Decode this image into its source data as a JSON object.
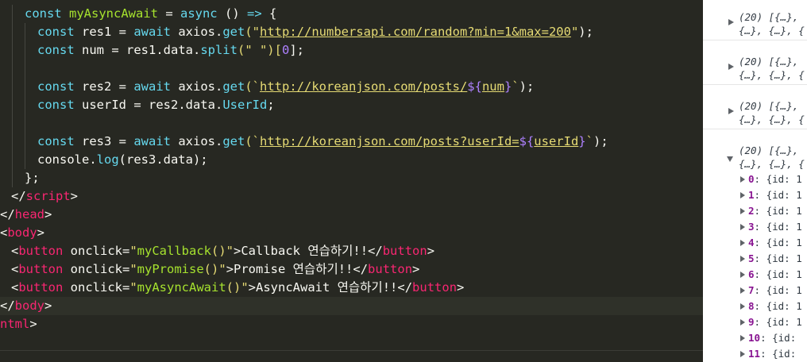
{
  "editor": {
    "lines": [
      [
        {
          "t": "const ",
          "c": "kw"
        },
        {
          "t": "myAsyncAwait",
          "c": "fn"
        },
        {
          "t": " = ",
          "c": "punct"
        },
        {
          "t": "async",
          "c": "kw"
        },
        {
          "t": " () ",
          "c": "punct"
        },
        {
          "t": "=>",
          "c": "kw"
        },
        {
          "t": " {",
          "c": "punct"
        }
      ],
      [
        {
          "t": "const ",
          "c": "kw"
        },
        {
          "t": "res1 = ",
          "c": "var"
        },
        {
          "t": "await ",
          "c": "kw"
        },
        {
          "t": "axios.",
          "c": "var"
        },
        {
          "t": "get",
          "c": "meth"
        },
        {
          "t": "(\"",
          "c": "str"
        },
        {
          "t": "http://numbersapi.com/random?min=1&max=200",
          "c": "url"
        },
        {
          "t": "\"",
          "c": "str"
        },
        {
          "t": ");",
          "c": "punct"
        }
      ],
      [
        {
          "t": "const ",
          "c": "kw"
        },
        {
          "t": "num = res1.data.",
          "c": "var"
        },
        {
          "t": "split",
          "c": "meth"
        },
        {
          "t": "(\" \")[",
          "c": "str"
        },
        {
          "t": "0",
          "c": "num"
        },
        {
          "t": "];",
          "c": "punct"
        }
      ],
      [],
      [
        {
          "t": "const ",
          "c": "kw"
        },
        {
          "t": "res2 = ",
          "c": "var"
        },
        {
          "t": "await ",
          "c": "kw"
        },
        {
          "t": "axios.",
          "c": "var"
        },
        {
          "t": "get",
          "c": "meth"
        },
        {
          "t": "(`",
          "c": "str"
        },
        {
          "t": "http://koreanjson.com/posts/",
          "c": "url"
        },
        {
          "t": "${",
          "c": "interp"
        },
        {
          "t": "num",
          "c": "url"
        },
        {
          "t": "}",
          "c": "interp"
        },
        {
          "t": "`",
          "c": "str"
        },
        {
          "t": ");",
          "c": "punct"
        }
      ],
      [
        {
          "t": "const ",
          "c": "kw"
        },
        {
          "t": "userId = res2.data.",
          "c": "var"
        },
        {
          "t": "UserId",
          "c": "meth"
        },
        {
          "t": ";",
          "c": "punct"
        }
      ],
      [],
      [
        {
          "t": "const ",
          "c": "kw"
        },
        {
          "t": "res3 = ",
          "c": "var"
        },
        {
          "t": "await ",
          "c": "kw"
        },
        {
          "t": "axios.",
          "c": "var"
        },
        {
          "t": "get",
          "c": "meth"
        },
        {
          "t": "(`",
          "c": "str"
        },
        {
          "t": "http://koreanjson.com/posts?userId=",
          "c": "url"
        },
        {
          "t": "${",
          "c": "interp"
        },
        {
          "t": "userId",
          "c": "url"
        },
        {
          "t": "}",
          "c": "interp"
        },
        {
          "t": "`",
          "c": "str"
        },
        {
          "t": ");",
          "c": "punct"
        }
      ],
      [
        {
          "t": "console.",
          "c": "var"
        },
        {
          "t": "log",
          "c": "meth"
        },
        {
          "t": "(res3.data);",
          "c": "punct"
        }
      ],
      [
        {
          "t": "};",
          "c": "punct"
        }
      ],
      [
        {
          "t": "</",
          "c": "punct"
        },
        {
          "t": "script",
          "c": "tag"
        },
        {
          "t": ">",
          "c": "punct"
        }
      ],
      [
        {
          "t": "</",
          "c": "punct"
        },
        {
          "t": "head",
          "c": "tag"
        },
        {
          "t": ">",
          "c": "punct"
        }
      ],
      [
        {
          "t": "<",
          "c": "punct"
        },
        {
          "t": "body",
          "c": "tag"
        },
        {
          "t": ">",
          "c": "punct"
        }
      ],
      [
        {
          "t": "<",
          "c": "punct"
        },
        {
          "t": "button ",
          "c": "tag"
        },
        {
          "t": "onclick=",
          "c": "attr"
        },
        {
          "t": "\"",
          "c": "str"
        },
        {
          "t": "myCallback",
          "c": "fn"
        },
        {
          "t": "()",
          "c": "str"
        },
        {
          "t": "\"",
          "c": "str"
        },
        {
          "t": ">Callback 연습하기!!</",
          "c": "txt"
        },
        {
          "t": "button",
          "c": "tag"
        },
        {
          "t": ">",
          "c": "punct"
        }
      ],
      [
        {
          "t": "<",
          "c": "punct"
        },
        {
          "t": "button ",
          "c": "tag"
        },
        {
          "t": "onclick=",
          "c": "attr"
        },
        {
          "t": "\"",
          "c": "str"
        },
        {
          "t": "myPromise",
          "c": "fn"
        },
        {
          "t": "()",
          "c": "str"
        },
        {
          "t": "\"",
          "c": "str"
        },
        {
          "t": ">Promise 연습하기!!</",
          "c": "txt"
        },
        {
          "t": "button",
          "c": "tag"
        },
        {
          "t": ">",
          "c": "punct"
        }
      ],
      [
        {
          "t": "<",
          "c": "punct"
        },
        {
          "t": "button ",
          "c": "tag"
        },
        {
          "t": "onclick=",
          "c": "attr"
        },
        {
          "t": "\"",
          "c": "str"
        },
        {
          "t": "myAsyncAwait",
          "c": "fn"
        },
        {
          "t": "()",
          "c": "str"
        },
        {
          "t": "\"",
          "c": "str"
        },
        {
          "t": ">AsyncAwait 연습하기!!</",
          "c": "txt"
        },
        {
          "t": "button",
          "c": "tag"
        },
        {
          "t": ">",
          "c": "punct"
        }
      ],
      [
        {
          "t": "</",
          "c": "punct"
        },
        {
          "t": "body",
          "c": "tag"
        },
        {
          "t": ">",
          "c": "punct"
        }
      ],
      [
        {
          "t": "ntml",
          "c": "tag"
        },
        {
          "t": ">",
          "c": "punct"
        }
      ]
    ],
    "active_line": 16
  },
  "console": {
    "collapsed_entries": [
      {
        "line1": "(20) [{…},",
        "line2": "{…}, {…}, {"
      },
      {
        "line1": "(20) [{…},",
        "line2": "{…}, {…}, {"
      },
      {
        "line1": "(20) [{…},",
        "line2": "{…}, {…}, {"
      }
    ],
    "expanded_entry": {
      "line1": "(20) [{…},",
      "line2": "{…}, {…}, {"
    },
    "rows": [
      {
        "key": "0",
        "val": "{id: 1"
      },
      {
        "key": "1",
        "val": "{id: 1"
      },
      {
        "key": "2",
        "val": "{id: 1"
      },
      {
        "key": "3",
        "val": "{id: 1"
      },
      {
        "key": "4",
        "val": "{id: 1"
      },
      {
        "key": "5",
        "val": "{id: 1"
      },
      {
        "key": "6",
        "val": "{id: 1"
      },
      {
        "key": "7",
        "val": "{id: 1"
      },
      {
        "key": "8",
        "val": "{id: 1"
      },
      {
        "key": "9",
        "val": "{id: 1"
      },
      {
        "key": "10",
        "val": "{id:"
      },
      {
        "key": "11",
        "val": "{id:"
      }
    ]
  },
  "colors": {
    "editor_bg": "#272822",
    "keyword": "#66d9ef",
    "function": "#a6e22e",
    "string": "#e6db74",
    "tag": "#f92672",
    "number": "#ae81ff",
    "console_key": "#881391"
  }
}
